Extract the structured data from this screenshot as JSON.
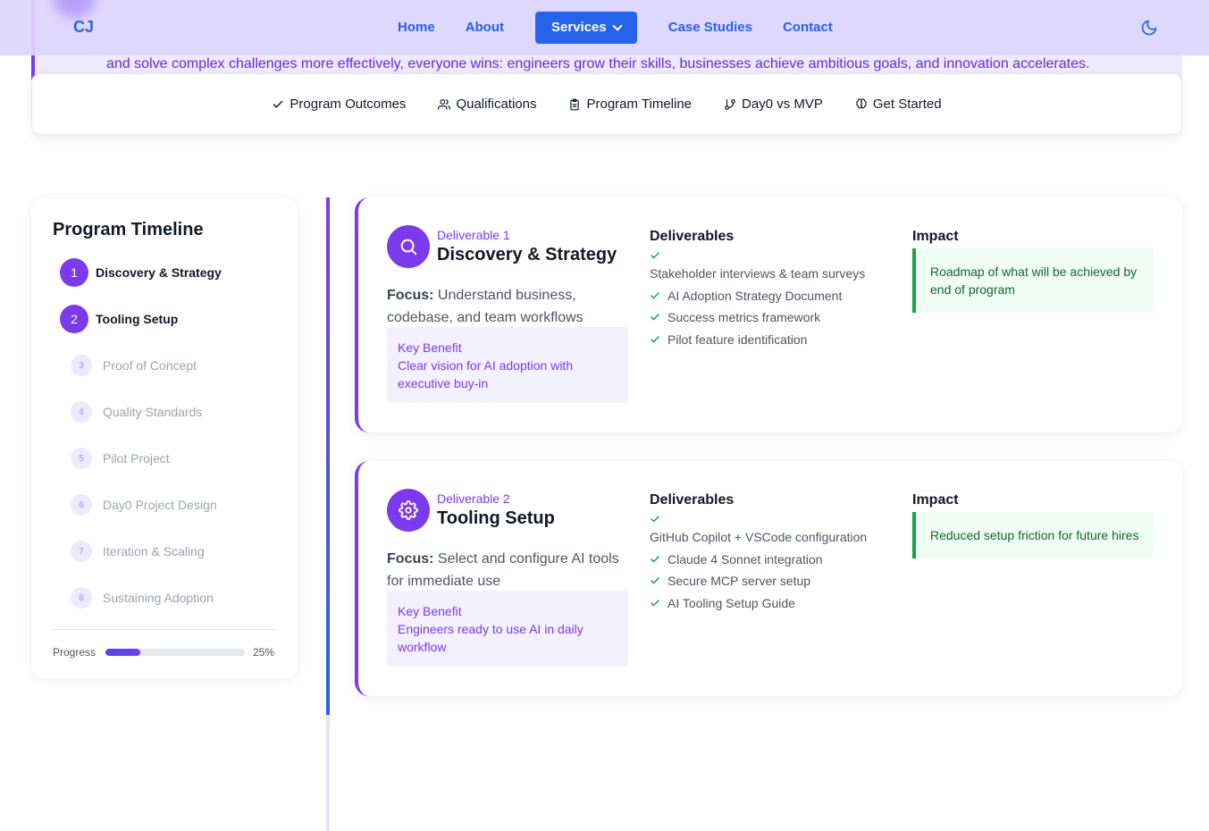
{
  "hero": {
    "text": "and solve complex challenges more effectively, everyone wins: engineers grow their skills, businesses achieve ambitious goals, and innovation accelerates."
  },
  "nav": {
    "logo": "CJ",
    "links": [
      "Home",
      "About",
      "Services",
      "Case Studies",
      "Contact"
    ],
    "active": "Services",
    "theme_icon": "moon-icon"
  },
  "subnav": {
    "items": [
      {
        "label": "Program Outcomes",
        "icon": "check-icon"
      },
      {
        "label": "Qualifications",
        "icon": "users-icon"
      },
      {
        "label": "Program Timeline",
        "icon": "clipboard-icon"
      },
      {
        "label": "Day0 vs MVP",
        "icon": "git-branch-icon"
      },
      {
        "label": "Get Started",
        "icon": "brain-icon"
      }
    ]
  },
  "sidebar": {
    "title": "Program Timeline",
    "steps": [
      {
        "num": "1",
        "label": "Discovery & Strategy"
      },
      {
        "num": "2",
        "label": "Tooling Setup"
      },
      {
        "num": "3",
        "label": "Proof of Concept"
      },
      {
        "num": "4",
        "label": "Quality Standards"
      },
      {
        "num": "5",
        "label": "Pilot Project"
      },
      {
        "num": "6",
        "label": "Day0 Project Design"
      },
      {
        "num": "7",
        "label": "Iteration & Scaling"
      },
      {
        "num": "8",
        "label": "Sustaining Adoption"
      }
    ],
    "progress_label": "Progress",
    "progress_value": "25%",
    "progress_fraction": 0.25
  },
  "cards": [
    {
      "deliverable_num": "Deliverable 1",
      "title": "Discovery & Strategy",
      "icon": "search-icon",
      "focus_label": "Focus:",
      "focus_text": "Understand business, codebase, and team workflows",
      "benefit_title": "Key Benefit",
      "benefit_text": "Clear vision for AI adoption with executive buy-in",
      "deliverables_heading": "Deliverables",
      "deliverables": [
        "Stakeholder interviews & team surveys",
        "AI Adoption Strategy Document",
        "Success metrics framework",
        "Pilot feature identification"
      ],
      "impact_heading": "Impact",
      "impact_text": "Roadmap of what will be achieved by end of program"
    },
    {
      "deliverable_num": "Deliverable 2",
      "title": "Tooling Setup",
      "icon": "gear-icon",
      "focus_label": "Focus:",
      "focus_text": "Select and configure AI tools for immediate use",
      "benefit_title": "Key Benefit",
      "benefit_text": "Engineers ready to use AI in daily workflow",
      "deliverables_heading": "Deliverables",
      "deliverables": [
        "GitHub Copilot + VSCode configuration",
        "Claude 4 Sonnet integration",
        "Secure MCP server setup",
        "AI Tooling Setup Guide"
      ],
      "impact_heading": "Impact",
      "impact_text": "Reduced setup friction for future hires"
    }
  ]
}
